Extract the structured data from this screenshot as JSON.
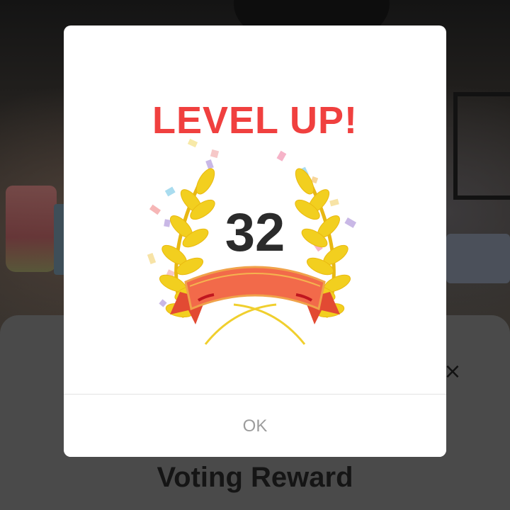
{
  "background": {
    "sheet_title": "Voting Reward",
    "close_glyph": "×",
    "sheet_color": "#4a4a4a"
  },
  "dialog": {
    "title": "LEVEL UP!",
    "level": "32",
    "ok_label": "OK",
    "title_color": "#f0403f",
    "badge_icon": "laurel-wreath-ribbon-icon",
    "confetti_icon": "confetti-icon"
  }
}
